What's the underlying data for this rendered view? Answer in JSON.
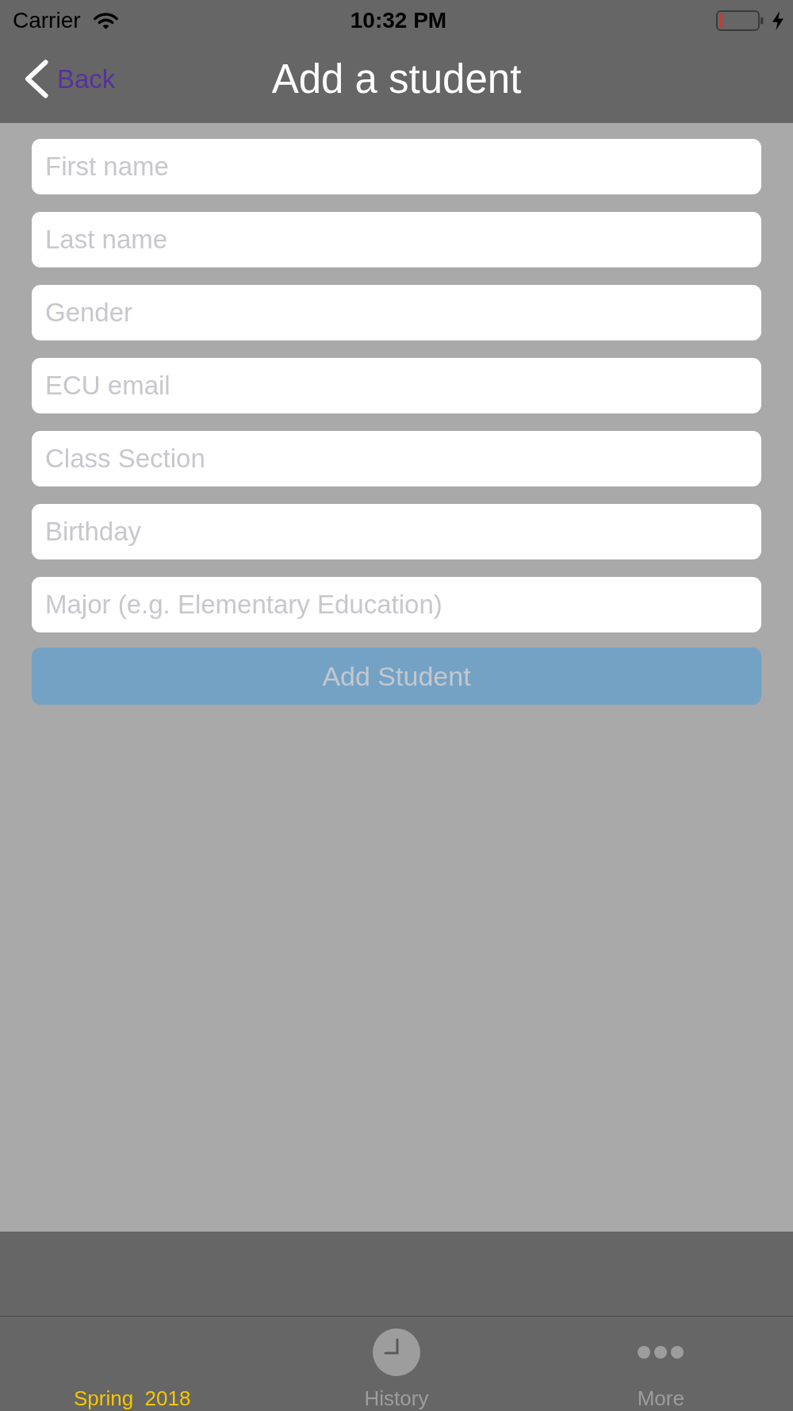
{
  "status_bar": {
    "carrier": "Carrier",
    "time": "10:32 PM"
  },
  "nav_bar": {
    "back_label": "Back",
    "title": "Add a student"
  },
  "fields": [
    {
      "placeholder": "First name"
    },
    {
      "placeholder": "Last name"
    },
    {
      "placeholder": "Gender"
    },
    {
      "placeholder": "ECU email"
    },
    {
      "placeholder": "Class Section"
    },
    {
      "placeholder": "Birthday"
    },
    {
      "placeholder": "Major (e.g. Elementary Education)"
    }
  ],
  "add_button": {
    "label": "Add Student",
    "disabled": true
  },
  "tabs": [
    {
      "label": "Spring  2018",
      "kind": "text",
      "selected": true
    },
    {
      "label": "History",
      "kind": "clock",
      "selected": false
    },
    {
      "label": "More",
      "kind": "more",
      "selected": false
    }
  ]
}
